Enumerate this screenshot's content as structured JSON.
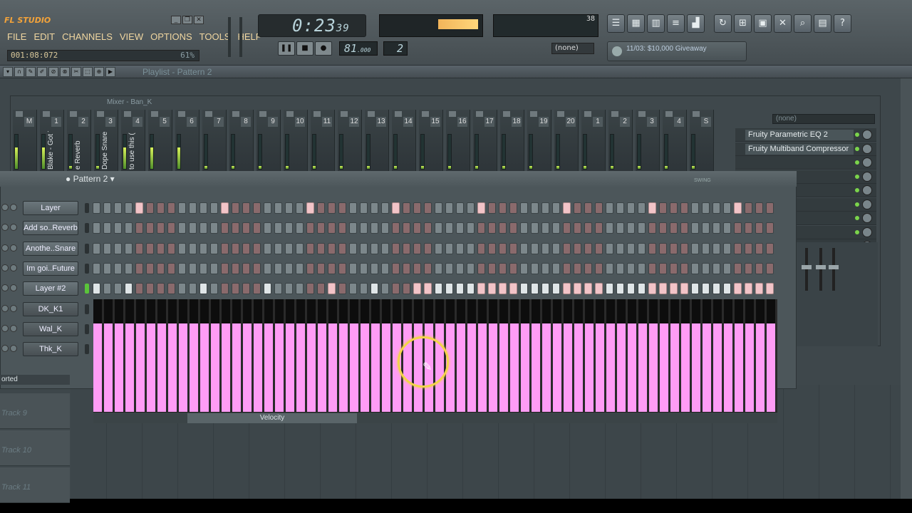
{
  "app": {
    "logo": "FL STUDIO"
  },
  "menu": [
    "FILE",
    "EDIT",
    "CHANNELS",
    "VIEW",
    "OPTIONS",
    "TOOLS",
    "HELP"
  ],
  "hint": {
    "time": "001:08:072",
    "percent": "61%"
  },
  "transport": {
    "time_main": "0:23",
    "time_small": "39",
    "tempo_main": "81",
    "tempo_small": ".000",
    "pattern": "2",
    "none_label": "(none)"
  },
  "cpu": {
    "voices": "38"
  },
  "news": {
    "text": "11/03: $10,000 Giveaway"
  },
  "playlist": {
    "title": "Playlist - Pattern 2"
  },
  "mixer": {
    "title": "Mixer - Ban_K",
    "fx_none": "(none)",
    "strips": [
      {
        "n": "M",
        "label": ""
      },
      {
        "n": "1",
        "label": "Blake - Got T"
      },
      {
        "n": "2",
        "label": "e Reverb"
      },
      {
        "n": "3",
        "label": "Dope Snare"
      },
      {
        "n": "4",
        "label": "to use this ("
      },
      {
        "n": "5",
        "label": ""
      },
      {
        "n": "6",
        "label": ""
      },
      {
        "n": "7",
        "label": ""
      },
      {
        "n": "8",
        "label": ""
      },
      {
        "n": "9",
        "label": ""
      },
      {
        "n": "10",
        "label": ""
      },
      {
        "n": "11",
        "label": ""
      },
      {
        "n": "12",
        "label": ""
      },
      {
        "n": "13",
        "label": ""
      },
      {
        "n": "14",
        "label": ""
      },
      {
        "n": "15",
        "label": ""
      },
      {
        "n": "16",
        "label": ""
      },
      {
        "n": "17",
        "label": ""
      },
      {
        "n": "18",
        "label": ""
      },
      {
        "n": "19",
        "label": ""
      },
      {
        "n": "20",
        "label": ""
      },
      {
        "n": "1",
        "label": ""
      },
      {
        "n": "2",
        "label": ""
      },
      {
        "n": "3",
        "label": ""
      },
      {
        "n": "4",
        "label": ""
      },
      {
        "n": "S",
        "label": ""
      }
    ],
    "fx_slots": [
      "Fruity Parametric EQ 2",
      "Fruity Multiband Compressor",
      "",
      "",
      "",
      "",
      "",
      "",
      "",
      ""
    ]
  },
  "stepseq": {
    "title": "Pattern 2",
    "channels": [
      {
        "name": "Layer"
      },
      {
        "name": "Add so..Reverb"
      },
      {
        "name": "Anothe..Snare"
      },
      {
        "name": "Im goi..Future"
      },
      {
        "name": "Layer #2"
      },
      {
        "name": "DK_K1"
      },
      {
        "name": "Wal_K"
      },
      {
        "name": "Thk_K"
      }
    ],
    "velocity_label": "Velocity",
    "imported_label": "orted"
  },
  "tracks": [
    "Track 9",
    "Track 10",
    "Track 11"
  ]
}
